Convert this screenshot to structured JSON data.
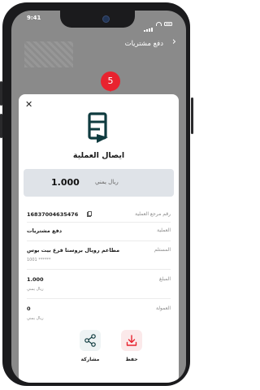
{
  "status_bar": {
    "time": "9:41"
  },
  "header": {
    "title": "دفع مشتريات",
    "back_icon": "chevron-right-icon"
  },
  "step_badge": "5",
  "receipt": {
    "title": "ايصال العملية",
    "amount": "1.000",
    "currency": "ريال يمني",
    "fields": [
      {
        "label": "رقم مرجع العملية",
        "value": "16837004635476"
      },
      {
        "label": "العملية",
        "value": "دفع مشتريات"
      },
      {
        "label": "المستلم",
        "value": "مطاعم رويال بروستا فرع بيت بوس",
        "sub": "1001 ******"
      },
      {
        "label": "المبلغ",
        "value": "1.000",
        "sub": "ريال يمني"
      },
      {
        "label": "العمولة",
        "value": "0",
        "sub": "ريال يمني"
      }
    ],
    "actions": {
      "share": "مشاركة",
      "save": "حفظ"
    }
  },
  "colors": {
    "accent": "#e8232f",
    "logo": "#0f3b3f",
    "amount_bg": "#dfe3e8"
  }
}
